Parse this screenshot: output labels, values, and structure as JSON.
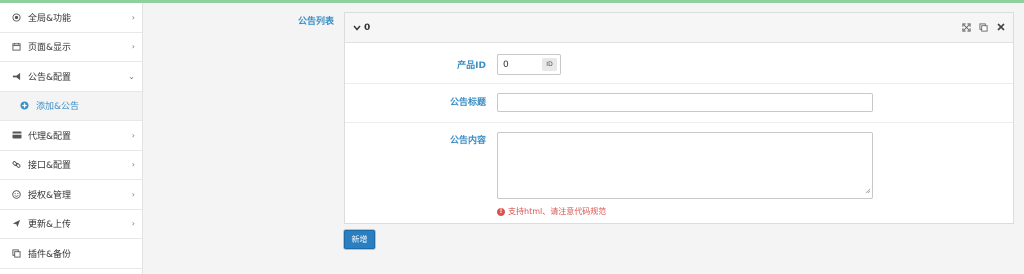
{
  "sidebar": {
    "items": [
      {
        "label": "全局&功能",
        "icon": "globe-icon",
        "arrow": "›"
      },
      {
        "label": "页面&显示",
        "icon": "calendar-icon",
        "arrow": "›"
      },
      {
        "label": "公告&配置",
        "icon": "bullhorn-icon",
        "arrow": "⌄"
      },
      {
        "label": "添加&公告",
        "icon": "plus-circle-icon"
      },
      {
        "label": "代理&配置",
        "icon": "credit-card-icon",
        "arrow": "›"
      },
      {
        "label": "接口&配置",
        "icon": "link-icon",
        "arrow": "›"
      },
      {
        "label": "授权&管理",
        "icon": "smile-icon",
        "arrow": "›"
      },
      {
        "label": "更新&上传",
        "icon": "paper-plane-icon",
        "arrow": "›"
      },
      {
        "label": "插件&备份",
        "icon": "copy-icon"
      }
    ]
  },
  "main": {
    "page_label": "公告列表",
    "panel": {
      "title": "0",
      "tools": [
        "expand-icon",
        "copy-icon",
        "close-icon"
      ]
    },
    "form": {
      "product_id_label": "产品ID",
      "product_id_value": "0",
      "product_id_addon": "ID",
      "title_label": "公告标题",
      "title_value": "",
      "content_label": "公告内容",
      "content_value": "",
      "hint": "支持html、请注意代码规范"
    },
    "submit_label": "新增"
  },
  "colors": {
    "accent": "#3a8fc6",
    "button": "#2b7fc0",
    "warning": "#d9534f",
    "top_bar": "#8fd19e"
  }
}
